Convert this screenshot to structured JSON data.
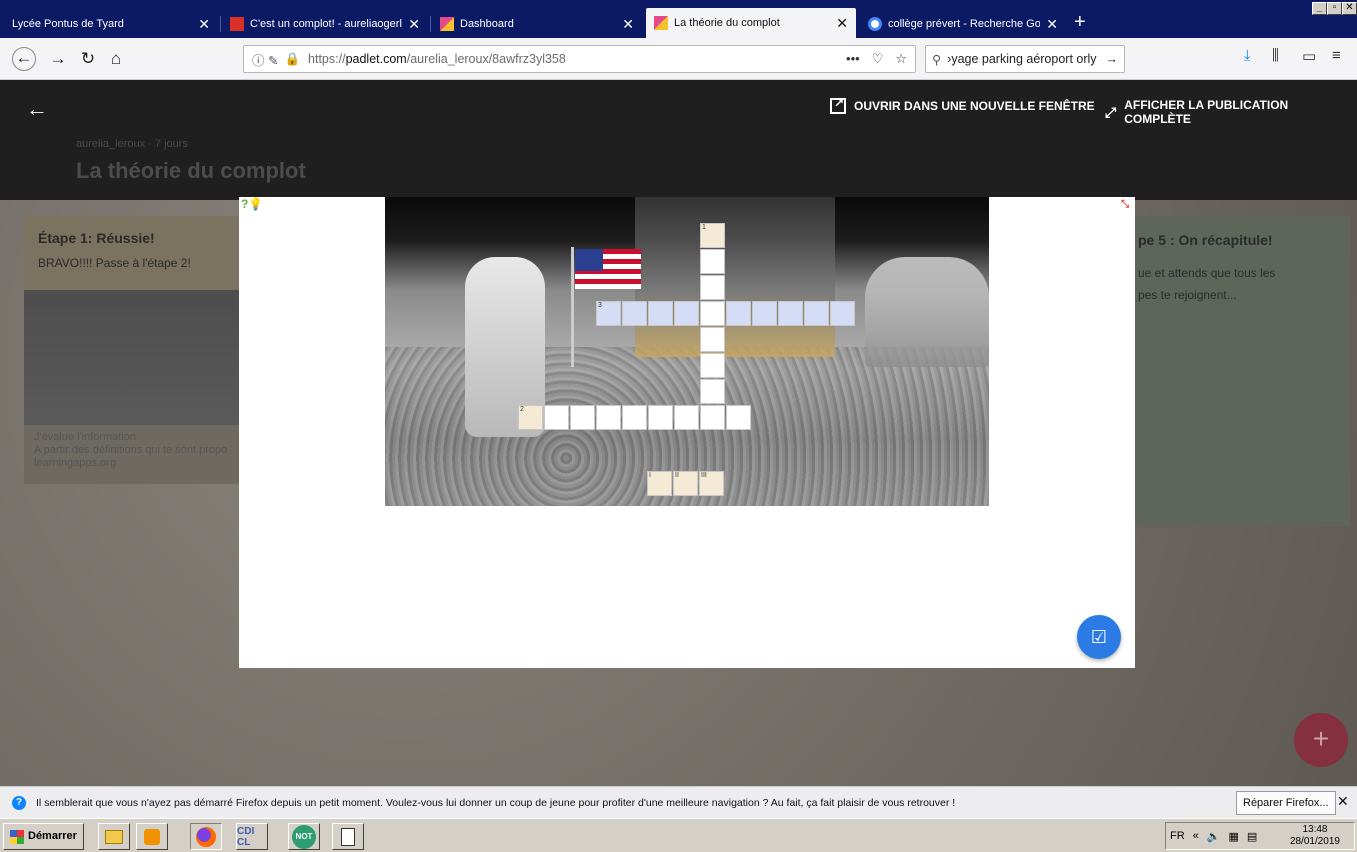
{
  "browser": {
    "tabs": [
      {
        "title": "Lycée Pontus de Tyard",
        "favicon_color": "#0c1a66",
        "active": false
      },
      {
        "title": "C'est un complot! - aureliaogerlero",
        "favicon_color": "#d93025",
        "active": false
      },
      {
        "title": "Dashboard",
        "favicon_color": "#e34a8c",
        "active": false
      },
      {
        "title": "La théorie du complot",
        "favicon_color": "#e34a8c",
        "active": true
      },
      {
        "title": "collège prévert - Recherche Googl",
        "favicon_color": "#4285f4",
        "active": false
      }
    ],
    "url": {
      "prefix": "https://",
      "domain": "padlet.com",
      "path": "/aurelia_leroux/8awfrz3yl358"
    },
    "search_value": "›yage parking aéroport orly",
    "accent": "#0c1a66"
  },
  "padlet": {
    "author": "aurelia_leroux",
    "age": "7 jours",
    "title": "La théorie du complot",
    "open_new_window": "OUVRIR DANS UNE NOUVELLE FENÊTRE",
    "show_full_post": "AFFICHER LA PUBLICATION COMPLÈTE",
    "card1": {
      "heading": "Étape 1: Réussie!",
      "body": "BRAVO!!!! Passe à l'étape 2!",
      "caption_title": "J'évalue l'information",
      "caption_text": "A partir des définitions qui te sont propo",
      "caption_source": "learningapps.org"
    },
    "card5": {
      "heading": "pe 5 : On récapitule!",
      "line1": "ue et attends que tous les",
      "line2": "pes te rejoignent..."
    }
  },
  "crossword": {
    "clue_labels": [
      "1",
      "2",
      "3"
    ],
    "bottom_labels": [
      "I",
      "II",
      "III"
    ]
  },
  "notification": {
    "text": "Il semblerait que vous n'ayez pas démarré Firefox depuis un petit moment. Voulez-vous lui donner un coup de jeune pour profiter d'une meilleure navigation ? Au fait, ça fait plaisir de vous retrouver !",
    "repair_label": "Réparer Firefox..."
  },
  "taskbar": {
    "start_label": "Démarrer",
    "apps": [
      "CDI CL",
      "NOT"
    ],
    "language": "FR",
    "time": "13:48",
    "date": "28/01/2019"
  }
}
